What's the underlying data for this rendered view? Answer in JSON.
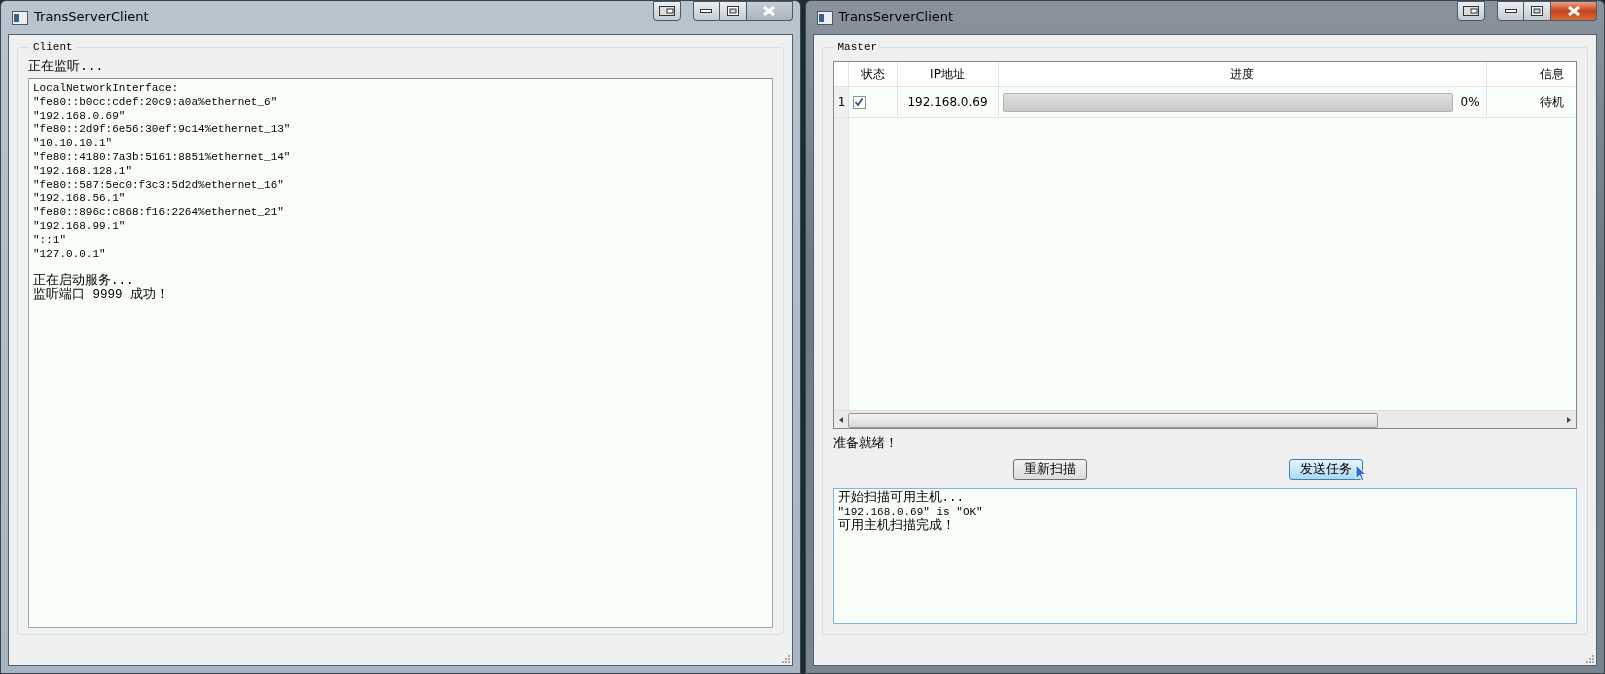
{
  "windows": [
    {
      "kind": "client",
      "title": "TransServerClient",
      "active": false,
      "group_title": "Client",
      "status": "正在监听...",
      "log_blocks": [
        [
          "LocalNetworkInterface:",
          "\"fe80::b0cc:cdef:20c9:a0a%ethernet_6\"",
          "\"192.168.0.69\"",
          "\"fe80::2d9f:6e56:30ef:9c14%ethernet_13\"",
          "\"10.10.10.1\"",
          "\"fe80::4180:7a3b:5161:8851%ethernet_14\"",
          "\"192.168.128.1\"",
          "\"fe80::587:5ec0:f3c3:5d2d%ethernet_16\"",
          "\"192.168.56.1\"",
          "\"fe80::896c:c868:f16:2264%ethernet_21\"",
          "\"192.168.99.1\"",
          "\"::1\"",
          "\"127.0.0.1\""
        ],
        [
          "正在启动服务...",
          "监听端口 9999 成功！"
        ]
      ]
    },
    {
      "kind": "master",
      "title": "TransServerClient",
      "active": true,
      "group_title": "Master",
      "table": {
        "columns": [
          "状态",
          "IP地址",
          "进度",
          "信息"
        ],
        "rows": [
          {
            "index": "1",
            "checked": true,
            "ip": "192.168.0.69",
            "level": 0,
            "reading": "0%",
            "info": "待机"
          }
        ]
      },
      "status": "准备就绪！",
      "buttons": [
        {
          "label": "重新扫描",
          "hovered": false
        },
        {
          "label": "发送任务",
          "hovered": true
        }
      ],
      "log_lines": [
        "开始扫描可用主机...",
        "\"192.168.0.69\" is \"OK\"",
        "可用主机扫描完成！"
      ]
    }
  ]
}
